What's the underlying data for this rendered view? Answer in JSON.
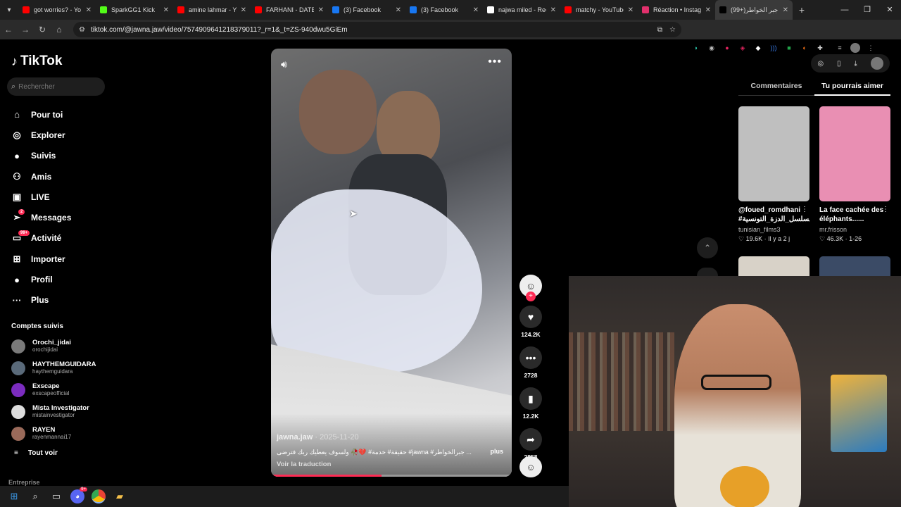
{
  "browser": {
    "tabs": [
      {
        "title": "got worries? - Yo",
        "color": "#ff0000"
      },
      {
        "title": "SparkGG1 Kick",
        "color": "#53fc18"
      },
      {
        "title": "amine lahmar - Yo",
        "color": "#ff0000"
      },
      {
        "title": "FARHANI - DATE",
        "color": "#ff0000"
      },
      {
        "title": "(3) Facebook",
        "color": "#1877f2"
      },
      {
        "title": "(3) Facebook",
        "color": "#1877f2"
      },
      {
        "title": "najwa miled - Rec",
        "color": "#ffffff"
      },
      {
        "title": "matchy - YouTube",
        "color": "#ff0000"
      },
      {
        "title": "Réaction • Instag",
        "color": "#e1306c"
      },
      {
        "title": "(99+)جبر الخواطر",
        "color": "#000000"
      }
    ],
    "url": "tiktok.com/@jawna.jaw/video/7574909641218379011?_r=1&_t=ZS-940dwu5GiEm"
  },
  "sidebar": {
    "brand": "TikTok",
    "search_placeholder": "Rechercher",
    "nav": [
      {
        "label": "Pour toi",
        "icon": "home-icon"
      },
      {
        "label": "Explorer",
        "icon": "compass-icon"
      },
      {
        "label": "Suivis",
        "icon": "following-avatar-icon"
      },
      {
        "label": "Amis",
        "icon": "friends-icon"
      },
      {
        "label": "LIVE",
        "icon": "live-icon"
      },
      {
        "label": "Messages",
        "icon": "messages-icon",
        "badge": "2"
      },
      {
        "label": "Activité",
        "icon": "activity-icon",
        "badge": "99+"
      },
      {
        "label": "Importer",
        "icon": "upload-icon"
      },
      {
        "label": "Profil",
        "icon": "profile-avatar-icon"
      },
      {
        "label": "Plus",
        "icon": "more-icon"
      }
    ],
    "following_title": "Comptes suivis",
    "following": [
      {
        "name": "Orochi_jidai",
        "handle": "orochijidai",
        "color": "#7a7a7a"
      },
      {
        "name": "HAYTHEMGUIDARA",
        "handle": "haythemguidara",
        "color": "#5a6a7a"
      },
      {
        "name": "Exscape",
        "handle": "exscapeofficial",
        "color": "#7b2cbf"
      },
      {
        "name": "Mista Investigator",
        "handle": "mistainvestigator",
        "color": "#dddddd"
      },
      {
        "name": "RAYEN",
        "handle": "rayenmannai17",
        "color": "#9a6a5a"
      }
    ],
    "see_all": "Tout voir",
    "enterprise": "Entreprise"
  },
  "video": {
    "author": "jawna.jaw",
    "date": "2025-11-20",
    "caption": "... جبرالخواطر# jawna# حقيقة# خدمة# 💔🥀 ولسوف يعطيك ربك فترضى",
    "more_label": "plus",
    "translate_label": "Voir la traduction",
    "progress": 0.46
  },
  "actions": {
    "likes": "124.2K",
    "comments": "2728",
    "saves": "12.2K",
    "shares": "2858"
  },
  "right_panel": {
    "tabs": [
      "Commentaires",
      "Tu pourrais aimer"
    ],
    "active_tab": 1,
    "cards": [
      {
        "title": "@foued_romdhani #مسلسل_الدزة_التونسية",
        "user": "tunisian_films3",
        "likes": "19.6K",
        "meta": "Il y a 2 j",
        "color": "#bfbfbf"
      },
      {
        "title": "La face cachée des éléphants......",
        "user": "mr.frisson",
        "likes": "46.3K",
        "meta": "1-26",
        "color": "#e98fb3"
      }
    ]
  },
  "taskbar": {
    "discord_badge": "9+"
  }
}
